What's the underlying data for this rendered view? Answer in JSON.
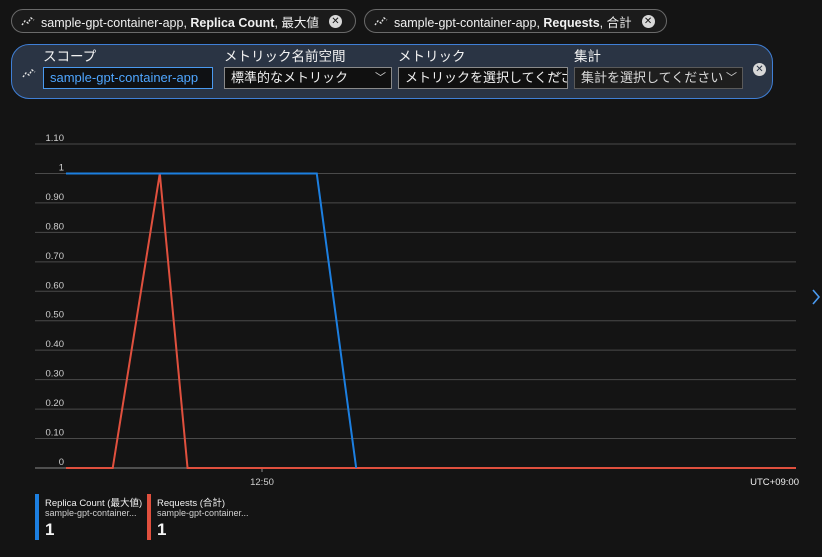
{
  "pills": [
    {
      "prefix": "sample-gpt-container-app, ",
      "metric": "Replica Count",
      "suffix": ", 最大値"
    },
    {
      "prefix": "sample-gpt-container-app, ",
      "metric": "Requests",
      "suffix": ", 合計"
    }
  ],
  "editor": {
    "scope_label": "スコープ",
    "scope_value": "sample-gpt-container-app",
    "namespace_label": "メトリック名前空間",
    "namespace_value": "標準的なメトリック",
    "metric_label": "メトリック",
    "metric_placeholder": "メトリックを選択してくださ",
    "aggregation_label": "集計",
    "aggregation_placeholder": "集計を選択してください"
  },
  "chart_data": {
    "type": "line",
    "y_ticks": [
      "1.10",
      "1",
      "0.90",
      "0.80",
      "0.70",
      "0.60",
      "0.50",
      "0.40",
      "0.30",
      "0.20",
      "0.10",
      "0"
    ],
    "ylim": [
      0,
      1.1
    ],
    "x_tick_label": "12:50",
    "timezone_label": "UTC+09:00",
    "series": [
      {
        "name": "Replica Count (最大値)",
        "color": "#1c7fe0",
        "points": [
          [
            0,
            1
          ],
          [
            0.3435,
            1
          ],
          [
            0.3975,
            0
          ]
        ]
      },
      {
        "name": "Requests (合計)",
        "color": "#e0503e",
        "points": [
          [
            0,
            0
          ],
          [
            0.064,
            0
          ],
          [
            0.1285,
            1
          ],
          [
            0.1665,
            0
          ],
          [
            1,
            0
          ]
        ]
      }
    ]
  },
  "legend": [
    {
      "name": "Replica Count (最大値)",
      "resource": "sample-gpt-container...",
      "value": "1",
      "color": "#1c7fe0"
    },
    {
      "name": "Requests (合計)",
      "resource": "sample-gpt-container...",
      "value": "1",
      "color": "#e0503e"
    }
  ],
  "icons": {
    "metric": "line-chart-icon",
    "close": "close-icon",
    "chevron": "chevron-down-icon",
    "next": "chevron-right-icon"
  }
}
